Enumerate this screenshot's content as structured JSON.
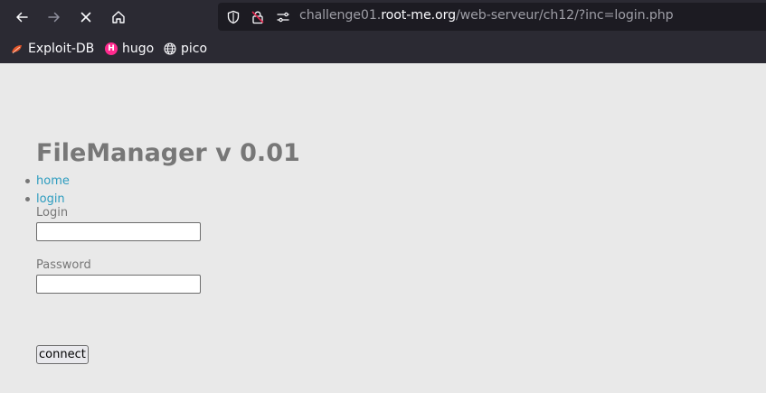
{
  "browser": {
    "url_prefix": "challenge01.",
    "url_domain": "root-me.org",
    "url_path": "/web-serveur/ch12/?inc=login.php",
    "nav_icons": [
      "back-icon",
      "forward-icon",
      "stop-icon",
      "home-icon"
    ],
    "bookmarks": [
      {
        "label": "Exploit-DB",
        "icon": "exploit-db-icon"
      },
      {
        "label": "hugo",
        "icon": "hugo-icon",
        "icon_text": "H"
      },
      {
        "label": "pico",
        "icon": "globe-icon"
      }
    ]
  },
  "page": {
    "title": "FileManager v 0.01",
    "nav": [
      {
        "label": "home"
      },
      {
        "label": "login"
      }
    ],
    "login_label": "Login",
    "login_value": "",
    "password_label": "Password",
    "password_value": "",
    "connect_label": "connect"
  },
  "colors": {
    "chrome_bg": "#2b2a33",
    "url_bg": "#1c1b22",
    "page_bg": "#e9e9e9",
    "title": "#777777",
    "link": "#2c9cbf",
    "hugo_badge": "#ff2a8e",
    "exploitdb_icon": "#e2562a"
  }
}
